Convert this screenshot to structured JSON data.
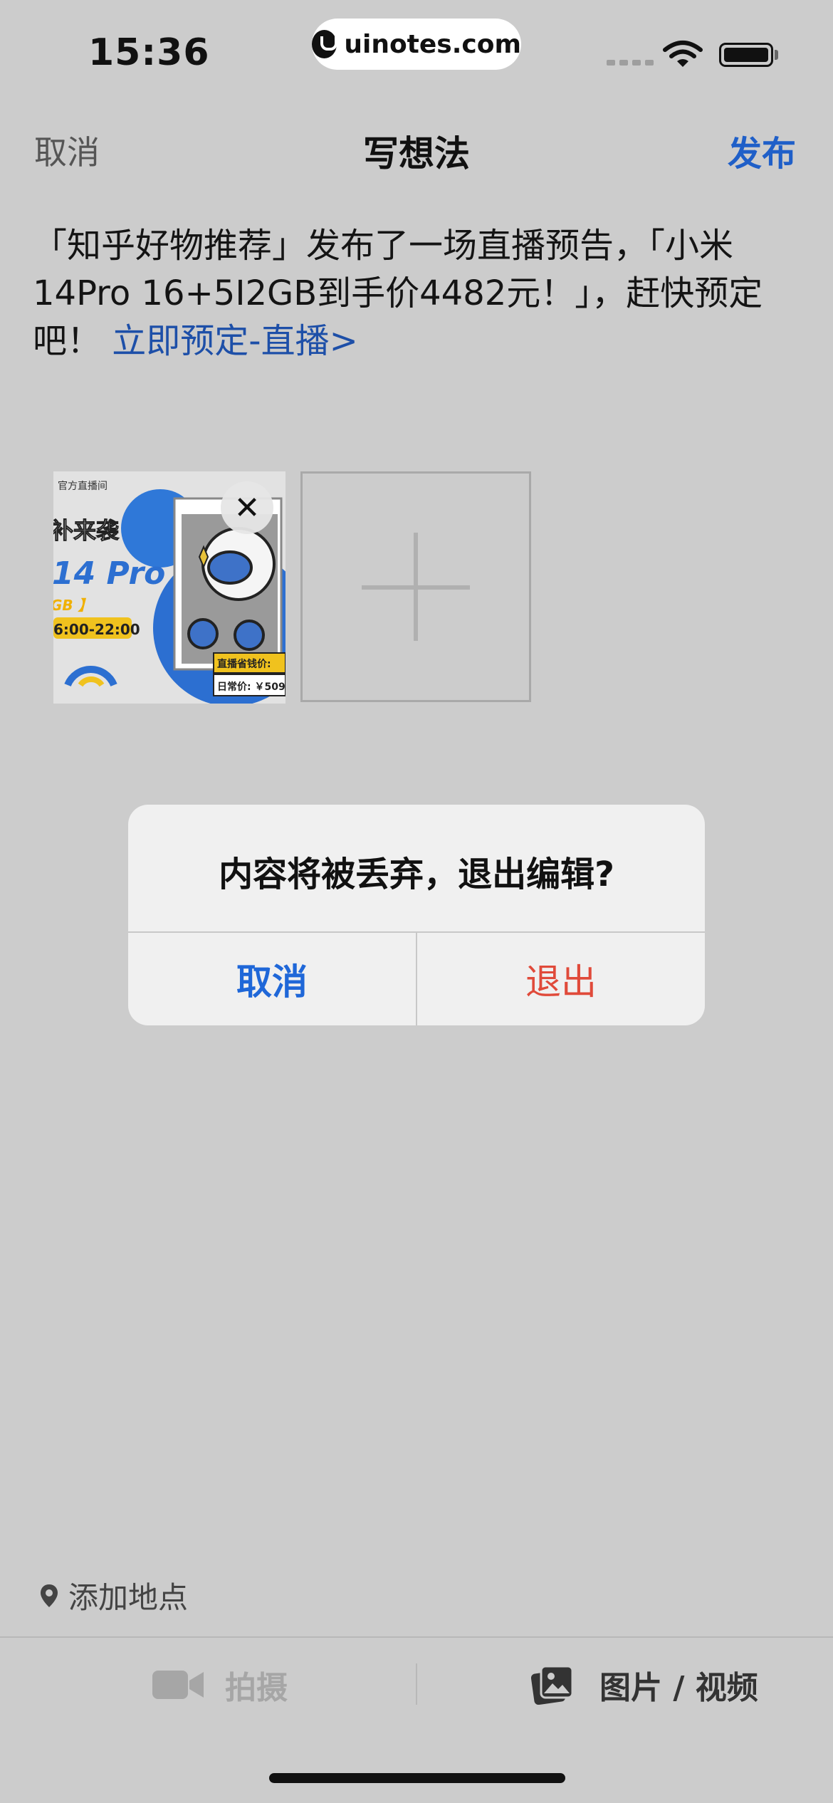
{
  "status_bar": {
    "time": "15:36",
    "url": "uinotes.com",
    "icons": [
      "signal-icon",
      "wifi-icon",
      "battery-icon"
    ]
  },
  "nav": {
    "cancel_label": "取消",
    "title": "写想法",
    "publish_label": "发布",
    "publish_color": "#1f5fc8"
  },
  "post": {
    "text": "「知乎好物推荐」发布了一场直播预告，「小米14Pro 16+5I2GB到手价4482元！」，赶快预定吧！ ",
    "link_text": "立即预定-直播>"
  },
  "thumbnail": {
    "badge": "官方直播间",
    "headline": "补来袭",
    "model": "14 Pro",
    "spec": "GB 】",
    "time_range": "6:00-22:00",
    "tag_live_price": "直播省钱价:",
    "tag_daily_price": "日常价: ￥509"
  },
  "dialog": {
    "message": "内容将被丢弃，退出编辑?",
    "cancel_label": "取消",
    "exit_label": "退出",
    "cancel_color": "#1f67d8",
    "exit_color": "#e04a3a"
  },
  "bottom": {
    "location_label": "添加地点",
    "camera_label": "拍摄",
    "gallery_label": "图片 / 视频"
  }
}
